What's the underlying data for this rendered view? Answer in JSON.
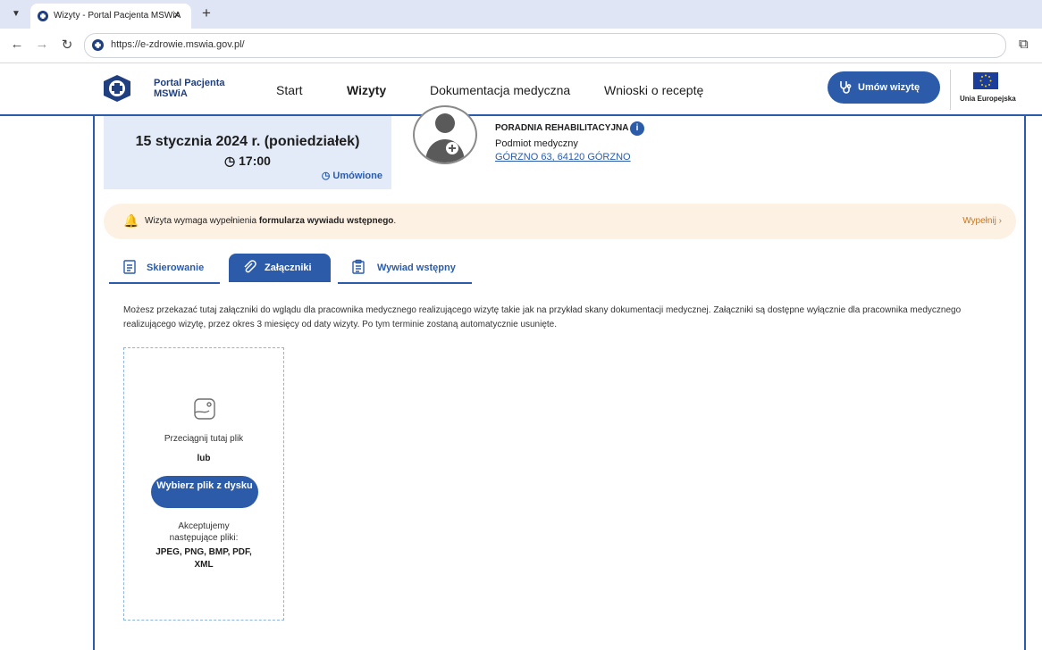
{
  "browser": {
    "tab_title": "Wizyty - Portal Pacjenta MSWiA",
    "url": "https://e-zdrowie.mswia.gov.pl/"
  },
  "site": {
    "brand_line1": "Portal Pacjenta",
    "brand_line2": "MSWiA",
    "nav": [
      "Start",
      "Wizyty",
      "Dokumentacja medyczna",
      "Wnioski o receptę"
    ],
    "cta": "Umów wizytę",
    "eu_label": "Unia Europejska"
  },
  "visit": {
    "date": "15 stycznia 2024 r. (poniedziałek)",
    "time": "17:00",
    "status": "Umówione",
    "clinic": "PORADNIA REHABILITACYJNA",
    "entity": "Podmiot medyczny",
    "address": "GÓRZNO 63, 64120 GÓRZNO"
  },
  "alert": {
    "text_prefix": "Wizyta wymaga wypełnienia ",
    "text_bold": "formularza wywiadu wstępnego",
    "text_suffix": ".",
    "action": "Wypełnij ›"
  },
  "tabs": [
    "Skierowanie",
    "Załączniki",
    "Wywiad wstępny"
  ],
  "description": "Możesz przekazać tutaj załączniki do wglądu dla pracownika medycznego realizującego wizytę takie jak na przykład skany dokumentacji medycznej. Załączniki są dostępne wyłącznie dla pracownika medycznego realizującego wizytę, przez okres 3 miesięcy od daty wizyty. Po tym terminie zostaną automatycznie usunięte.",
  "upload": {
    "drag_text": "Przeciągnij tutaj plik",
    "or_text": "lub",
    "button": "Wybierz plik z dysku",
    "accept_text": "Akceptujemy następujące pliki:",
    "formats": "JPEG, PNG, BMP, PDF, XML"
  },
  "colors": {
    "primary": "#2c5ca9",
    "alert_bg": "#fdf1e4",
    "date_bg": "#e3ebf8"
  }
}
